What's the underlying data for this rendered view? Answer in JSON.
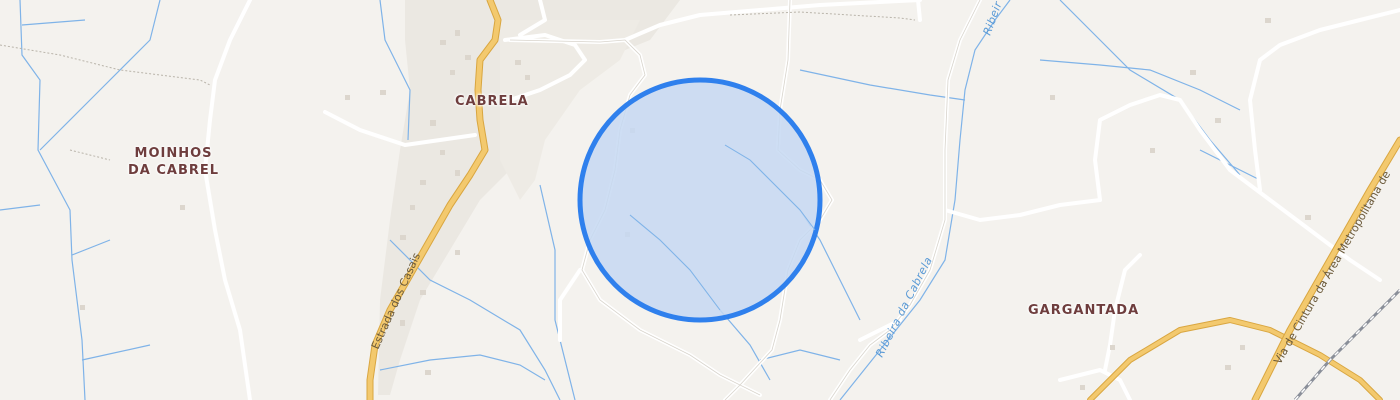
{
  "map": {
    "places": {
      "cabrela": "CABRELA",
      "moinhos_line1": "MOINHOS",
      "moinhos_line2": "DA CABREL",
      "gargantada": "GARGANTADA"
    },
    "roads": {
      "estrada_dos_casais": "Estrada dos Casais",
      "via_cintura": "Via de Cintura da Área Metropolitana de"
    },
    "waterways": {
      "ribeira_da_cabrela": "Ribeira da Cabrela",
      "ribeira_partial": "Ribeir"
    },
    "colors": {
      "background": "#f4f2ee",
      "main_road": "#f3c96e",
      "minor_road": "#ffffff",
      "stream": "#7fb3e8",
      "railway": "#8a8f99",
      "search_area_fill": "#c6d8f2",
      "search_area_stroke": "#2f80ed",
      "place_label": "#6e3d3d"
    },
    "search_area": "circle"
  }
}
